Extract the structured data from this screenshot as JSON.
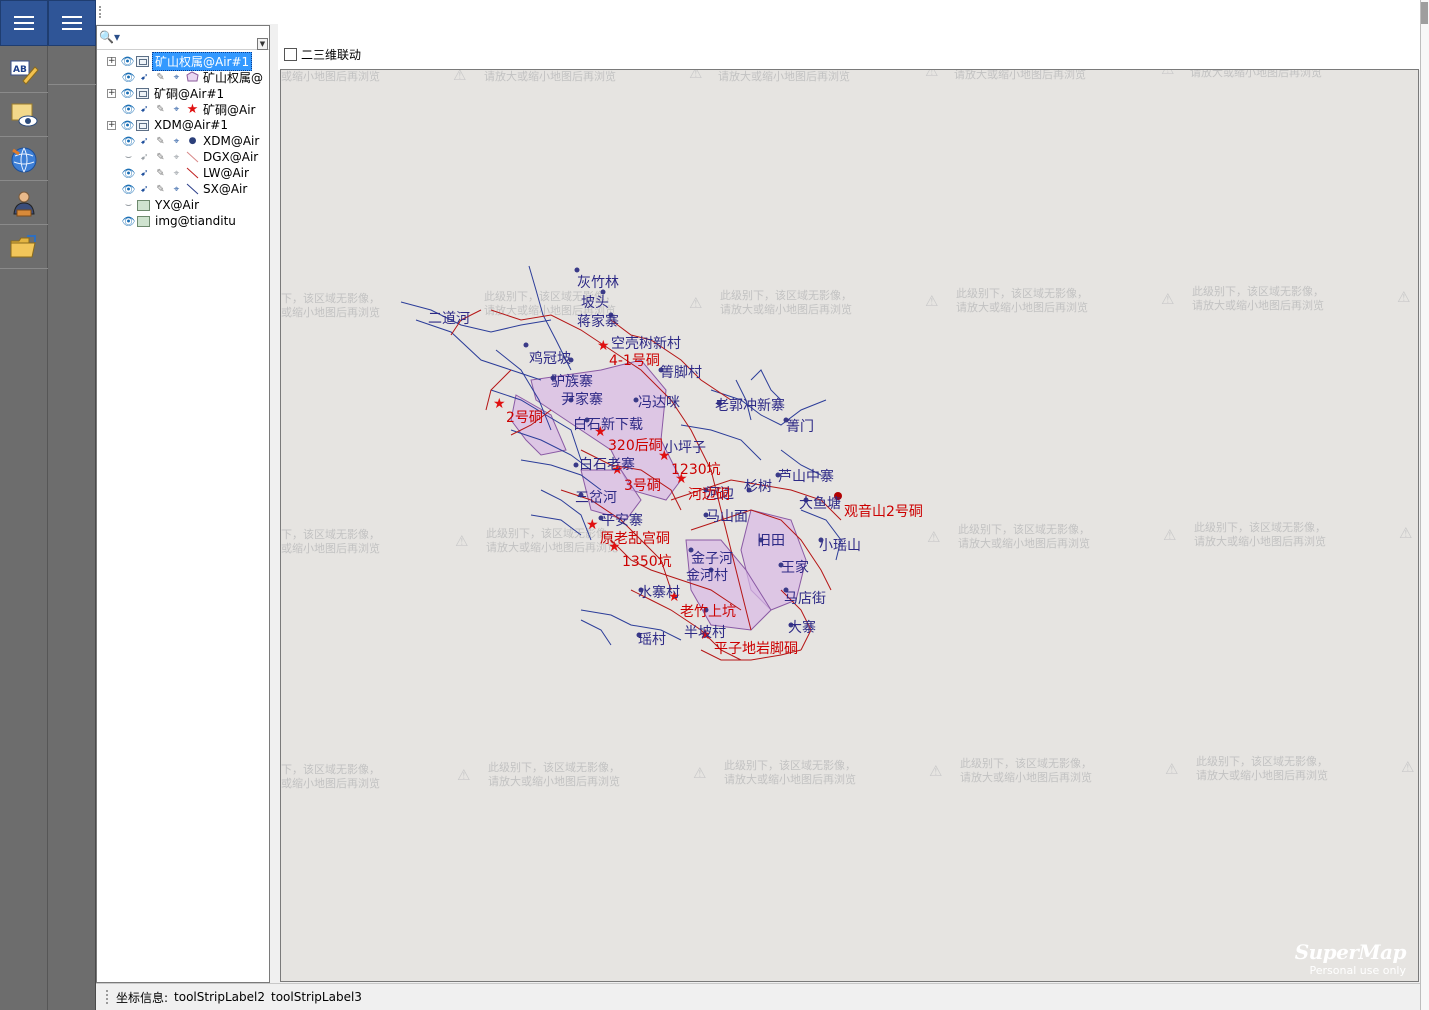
{
  "rail": {
    "tools": [
      {
        "name": "label-edit-icon",
        "glyph": "AB"
      },
      {
        "name": "view-eye-icon",
        "glyph": "👁"
      },
      {
        "name": "globe-icon",
        "glyph": "🌐"
      },
      {
        "name": "user-icon",
        "glyph": "👤"
      },
      {
        "name": "open-folder-icon",
        "glyph": "📂"
      }
    ]
  },
  "layer_panel": {
    "search_glyph": "🔍▾",
    "scroll_glyph": "▼",
    "layers": [
      {
        "label": "矿山权属@Air#1",
        "type": "group",
        "expander": "+",
        "eye": "visible",
        "selected": true
      },
      {
        "label": "矿山权属@",
        "type": "region",
        "eye": "visible"
      },
      {
        "label": "矿硐@Air#1",
        "type": "group",
        "expander": "+",
        "eye": "visible"
      },
      {
        "label": "矿硐@Air",
        "type": "point-star",
        "eye": "visible"
      },
      {
        "label": "XDM@Air#1",
        "type": "group",
        "expander": "+",
        "eye": "visible"
      },
      {
        "label": "XDM@Air",
        "type": "point",
        "eye": "visible"
      },
      {
        "label": "DGX@Air",
        "type": "line",
        "eye": "hidden"
      },
      {
        "label": "LW@Air",
        "type": "line",
        "eye": "visible"
      },
      {
        "label": "SX@Air",
        "type": "line",
        "eye": "visible"
      },
      {
        "label": "YX@Air",
        "type": "raster",
        "eye": "hidden"
      },
      {
        "label": "img@tianditu",
        "type": "raster",
        "eye": "visible"
      }
    ]
  },
  "main": {
    "sync_checkbox_label": "二三维联动",
    "sync_checked": false,
    "tile_message_line1": "此级别下，该区域无影像，",
    "tile_message_line2": "请放大或缩小地图后再浏览",
    "tile_message_partial1": "下，该区域无影像，",
    "tile_message_partial2": "或缩小地图后再浏览",
    "watermark_logo": "SuperMap",
    "watermark_sub": "Personal use only"
  },
  "map_labels": {
    "places": [
      "灰竹林",
      "坡头",
      "蒋家寨",
      "二道河",
      "空壳树新村",
      "鸡冠坡",
      "箐脚村",
      "驴族寨",
      "尹家寨",
      "冯达咪",
      "老郭冲新寨",
      "白石新下载",
      "箐门",
      "小坪子",
      "白石老寨",
      "芦山中寨",
      "杉树",
      "河边",
      "三岔河",
      "大鱼塘",
      "平安寨",
      "马山面",
      "小瑶山",
      "旧田",
      "金子河",
      "金河村",
      "王家",
      "马店街",
      "水寨村",
      "半坡村",
      "大寨",
      "瑶村"
    ],
    "mines": [
      "4-1号硐",
      "2号硐",
      "320后硐",
      "1230坑",
      "3号硐",
      "河边硐",
      "观音山2号硐",
      "原老乱宫硐",
      "1350坑",
      "老竹上坑",
      "平子地岩脚硐"
    ]
  },
  "status": {
    "coord_label": "坐标信息:",
    "label2": "toolStripLabel2",
    "label3": "toolStripLabel3"
  }
}
